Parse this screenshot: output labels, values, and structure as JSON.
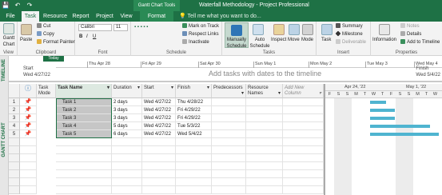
{
  "window": {
    "title": "Waterfall Methodology - Project Professional",
    "context_title": "Gantt Chart Tools"
  },
  "qat": {
    "save": "💾",
    "undo": "↶",
    "redo": "↷"
  },
  "tabs": [
    "File",
    "Task",
    "Resource",
    "Report",
    "Project",
    "View",
    "Format"
  ],
  "tell_me": "Tell me what you want to do...",
  "ribbon": {
    "view": {
      "gantt": "Gantt Chart",
      "group": "View"
    },
    "clipboard": {
      "paste": "Paste",
      "cut": "Cut",
      "copy": "Copy",
      "format_painter": "Format Painter",
      "group": "Clipboard"
    },
    "font": {
      "family": "Calibri",
      "size": "11",
      "bold": "B",
      "italic": "I",
      "underline": "U",
      "group": "Font"
    },
    "schedule": {
      "mark_on_track": "Mark on Track",
      "respect_links": "Respect Links",
      "inactivate": "Inactivate",
      "group": "Schedule"
    },
    "tasks": {
      "manually": "Manually Schedule",
      "auto": "Auto Schedule",
      "inspect": "Inspect",
      "move": "Move",
      "mode": "Mode",
      "group": "Tasks"
    },
    "insert": {
      "task": "Task",
      "summary": "Summary",
      "milestone": "Milestone",
      "deliverable": "Deliverable",
      "group": "Insert"
    },
    "properties": {
      "information": "Information",
      "notes": "Notes",
      "details": "Details",
      "add_timeline": "Add to Timeline",
      "group": "Properties"
    }
  },
  "timeline": {
    "side_label": "TIMELINE",
    "today": "Today",
    "start_label": "Start",
    "start_date": "Wed 4/27/22",
    "finish_label": "Finish",
    "finish_date": "Wed 5/4/22",
    "dates": [
      "Thu Apr 28",
      "Fri Apr 29",
      "Sat Apr 30",
      "Sun May 1",
      "Mon May 2",
      "Tue May 3",
      "Wed May 4"
    ],
    "message": "Add tasks with dates to the timeline"
  },
  "grid": {
    "side_label": "GANTT CHART",
    "headers": {
      "info": "ⓘ",
      "mode": "Task Mode",
      "name": "Task Name",
      "duration": "Duration",
      "start": "Start",
      "finish": "Finish",
      "predecessors": "Predecessors",
      "resources": "Resource Names",
      "add": "Add New Column"
    },
    "rows": [
      {
        "num": "1",
        "mode": "📌",
        "name": "Task 1",
        "duration": "2 days",
        "start": "Wed 4/27/22",
        "finish": "Thu 4/28/22"
      },
      {
        "num": "2",
        "mode": "📌",
        "name": "Task 2",
        "duration": "3 days",
        "start": "Wed 4/27/22",
        "finish": "Fri 4/29/22"
      },
      {
        "num": "3",
        "mode": "📌",
        "name": "Task 3",
        "duration": "3 days",
        "start": "Wed 4/27/22",
        "finish": "Fri 4/29/22"
      },
      {
        "num": "4",
        "mode": "📌",
        "name": "Task 4",
        "duration": "5 days",
        "start": "Wed 4/27/22",
        "finish": "Tue 5/3/22"
      },
      {
        "num": "5",
        "mode": "📌",
        "name": "Task 5",
        "duration": "6 days",
        "start": "Wed 4/27/22",
        "finish": "Wed 5/4/22"
      }
    ]
  },
  "gantt": {
    "weeks": [
      "Apr 24, '22",
      "May 1, '22"
    ],
    "days": [
      "F",
      "S",
      "S",
      "M",
      "T",
      "W",
      "T",
      "F",
      "S",
      "S",
      "M",
      "T",
      "W",
      "T"
    ],
    "bar_color": "#4fb4d0",
    "task_durations_days": [
      2,
      3,
      3,
      5,
      6
    ]
  },
  "colors": {
    "brand": "#1e7145",
    "name_highlight": "#c6c6c6"
  }
}
